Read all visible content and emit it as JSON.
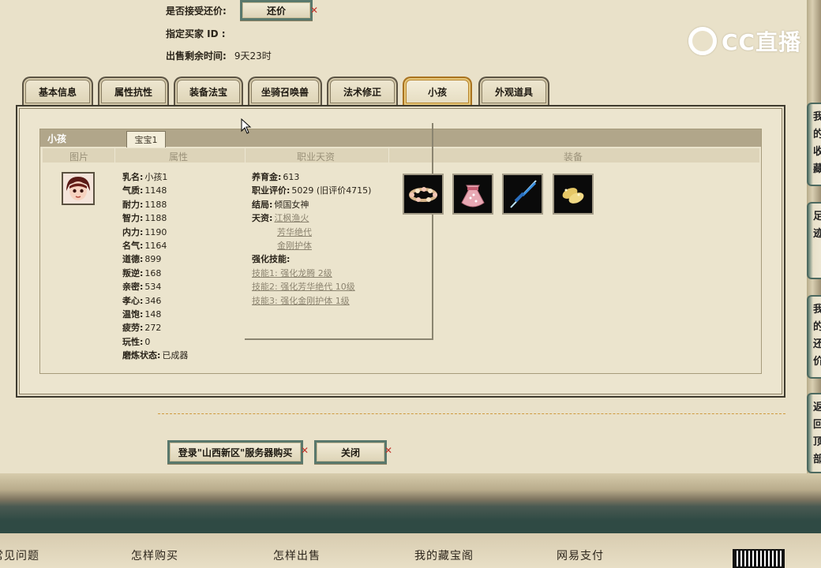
{
  "header": {
    "accept_counter_label": "是否接受还价:",
    "counter_button": "还价",
    "buyer_id_label": "指定买家 ID :",
    "buyer_id_value": "",
    "time_left_label": "出售剩余时间:",
    "time_left_value": "9天23时"
  },
  "watermark": "CC直播",
  "tabs": [
    {
      "label": "基本信息",
      "active": false
    },
    {
      "label": "属性抗性",
      "active": false
    },
    {
      "label": "装备法宝",
      "active": false
    },
    {
      "label": "坐骑召唤兽",
      "active": false
    },
    {
      "label": "法术修正",
      "active": false
    },
    {
      "label": "小孩",
      "active": true
    },
    {
      "label": "外观道具",
      "active": false
    }
  ],
  "child_panel": {
    "title": "小孩",
    "subtab": "宝宝1",
    "columns": [
      "图片",
      "属性",
      "职业天资",
      "装备"
    ],
    "attributes": [
      {
        "k": "乳名:",
        "v": "小孩1"
      },
      {
        "k": "气质:",
        "v": "1148"
      },
      {
        "k": "耐力:",
        "v": "1188"
      },
      {
        "k": "智力:",
        "v": "1188"
      },
      {
        "k": "内力:",
        "v": "1190"
      },
      {
        "k": "名气:",
        "v": "1164"
      },
      {
        "k": "道德:",
        "v": "899"
      },
      {
        "k": "叛逆:",
        "v": "168"
      },
      {
        "k": "亲密:",
        "v": "534"
      },
      {
        "k": "孝心:",
        "v": "346"
      },
      {
        "k": "温饱:",
        "v": "148"
      },
      {
        "k": "疲劳:",
        "v": "272"
      },
      {
        "k": "玩性:",
        "v": "0"
      },
      {
        "k": "磨炼状态:",
        "v": "已成器"
      }
    ],
    "talent": {
      "raise_gold_label": "养育金:",
      "raise_gold": "613",
      "career_score_label": "职业评价:",
      "career_score": "5029 (旧评价4715)",
      "ending_label": "结局:",
      "ending": "倾国女神",
      "gift_label": "天资:",
      "gifts": [
        "江枫渔火",
        "芳华绝代",
        "金刚护体"
      ],
      "skills_label": "强化技能:",
      "skills": [
        "技能1: 强化龙腾 2级",
        "技能2: 强化芳华绝代 10级",
        "技能3: 强化金刚护体 1级"
      ]
    },
    "equipment": [
      "flower-wreath-icon",
      "pink-pouch-icon",
      "blue-umbrella-icon",
      "gold-shoes-icon"
    ]
  },
  "actions": {
    "login_buy": "登录\"山西新区\"服务器购买",
    "close": "关闭"
  },
  "side_tabs": [
    "我的收藏",
    "足迹",
    "我的还价",
    "返回顶部"
  ],
  "footer": [
    "常见问题",
    "怎样购买",
    "怎样出售",
    "我的藏宝阁",
    "网易支付"
  ]
}
